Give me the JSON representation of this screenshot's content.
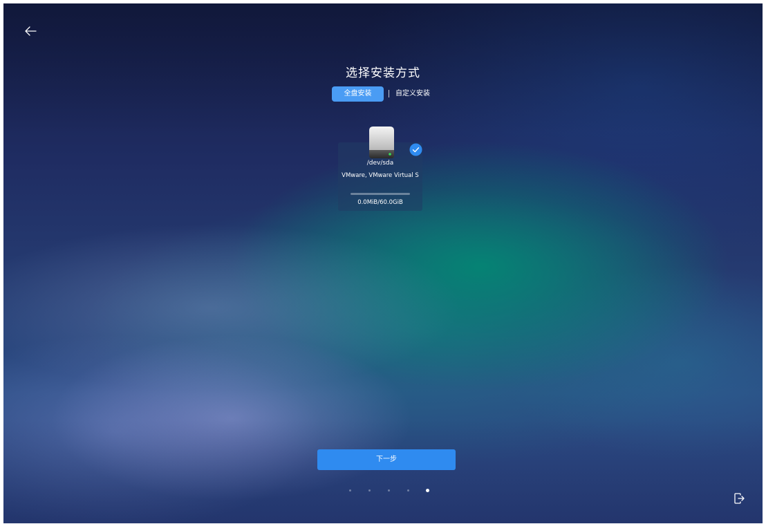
{
  "header": {
    "back_icon": "arrow-left-icon",
    "title": "选择安装方式"
  },
  "tabs": {
    "full_disk": "全盘安装",
    "custom": "自定义安装",
    "selected": "全盘安装"
  },
  "disks": [
    {
      "icon": "hard-drive-icon",
      "name": "/dev/sda",
      "model": "VMware, VMware Virtual S",
      "usage_fraction": 0.0,
      "size": "0.0MiB/60.0GiB",
      "selected": true
    }
  ],
  "footer": {
    "next_label": "下一步",
    "steps_total": 5,
    "current_step": 5,
    "exit_icon": "exit-icon"
  },
  "colors": {
    "accent": "#2f8bf0",
    "tab_active": "#4a9cf4",
    "check": "#2f8bf0"
  }
}
